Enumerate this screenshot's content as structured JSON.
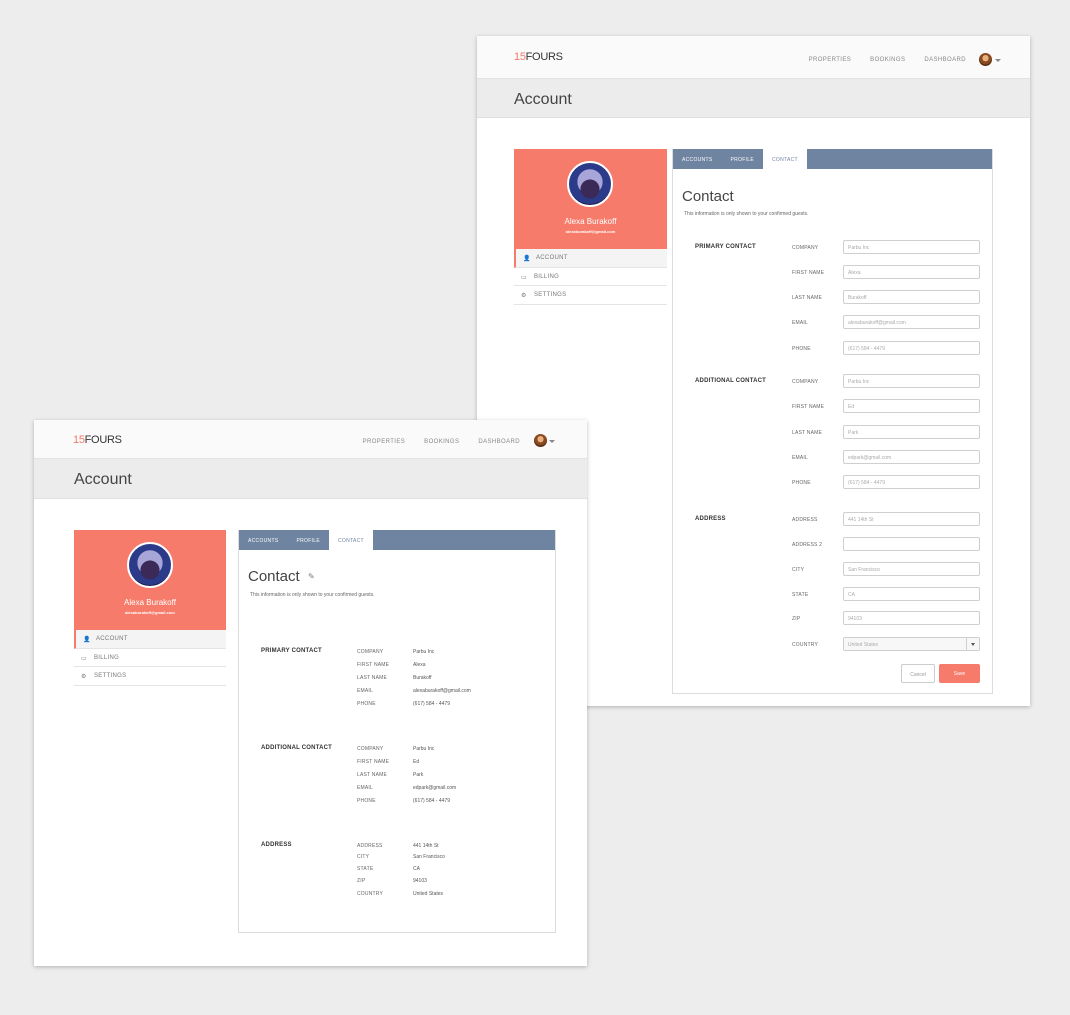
{
  "brand": {
    "logo_number": "15",
    "logo_text": "FOURS",
    "accent": "#f67b6a",
    "tab_bar": "#6f84a0"
  },
  "nav": {
    "links": [
      "PROPERTIES",
      "BOOKINGS",
      "DASHBOARD"
    ],
    "avatar_icon": "user-avatar"
  },
  "page_title": "Account",
  "profile": {
    "name": "Alexa Burakoff",
    "email": "alexaburakoff@gmail.com"
  },
  "sidebar": {
    "items": [
      {
        "label": "ACCOUNT",
        "icon": "user-icon",
        "glyph": "👤"
      },
      {
        "label": "BILLING",
        "icon": "credit-card-icon",
        "glyph": "▭"
      },
      {
        "label": "SETTINGS",
        "icon": "gear-icon",
        "glyph": "⚙"
      }
    ]
  },
  "tabs": [
    "ACCOUNTS",
    "PROFILE",
    "CONTACT"
  ],
  "contact": {
    "title": "Contact",
    "subtitle": "This information is only shown to your confirmed guests."
  },
  "edit_form": {
    "primary_heading": "PRIMARY CONTACT",
    "additional_heading": "ADDITIONAL CONTACT",
    "address_heading": "ADDRESS",
    "primary": {
      "labels": [
        "COMPANY",
        "FIRST NAME",
        "LAST NAME",
        "EMAIL",
        "PHONE"
      ],
      "values": [
        "Parbu Inc",
        "Alexa",
        "Burakoff",
        "alexaburakoff@gmail.com",
        "(617) 584 - 4479"
      ]
    },
    "additional": {
      "labels": [
        "COMPANY",
        "FIRST NAME",
        "LAST NAME",
        "EMAIL",
        "PHONE"
      ],
      "values": [
        "Parbu Inc",
        "Ed",
        "Park",
        "edpark@gmail.com",
        "(617) 584 - 4479"
      ]
    },
    "address": {
      "labels": [
        "ADDRESS",
        "ADDRESS 2",
        "CITY",
        "STATE",
        "ZIP",
        "COUNTRY"
      ],
      "values": [
        "441 14th St",
        "",
        "San Francisco",
        "CA",
        "94103",
        "United States"
      ]
    },
    "cancel_label": "Cancel",
    "save_label": "Save"
  },
  "view": {
    "primary_heading": "PRIMARY CONTACT",
    "additional_heading": "ADDITIONAL CONTACT",
    "address_heading": "ADDRESS",
    "primary": {
      "labels": [
        "COMPANY",
        "FIRST NAME",
        "LAST NAME",
        "EMAIL",
        "PHONE"
      ],
      "values": [
        "Parbu Inc",
        "Alexa",
        "Burakoff",
        "alexaburakoff@gmail.com",
        "(617) 584 - 4479"
      ]
    },
    "additional": {
      "labels": [
        "COMPANY",
        "FIRST NAME",
        "LAST NAME",
        "EMAIL",
        "PHONE"
      ],
      "values": [
        "Parbu Inc",
        "Ed",
        "Park",
        "edpark@gmail.com",
        "(617) 584 - 4479"
      ]
    },
    "address": {
      "labels": [
        "ADDRESS",
        "CITY",
        "STATE",
        "ZIP",
        "COUNTRY"
      ],
      "values": [
        "441 14th St",
        "San Francisco",
        "CA",
        "94103",
        "United States"
      ]
    }
  }
}
